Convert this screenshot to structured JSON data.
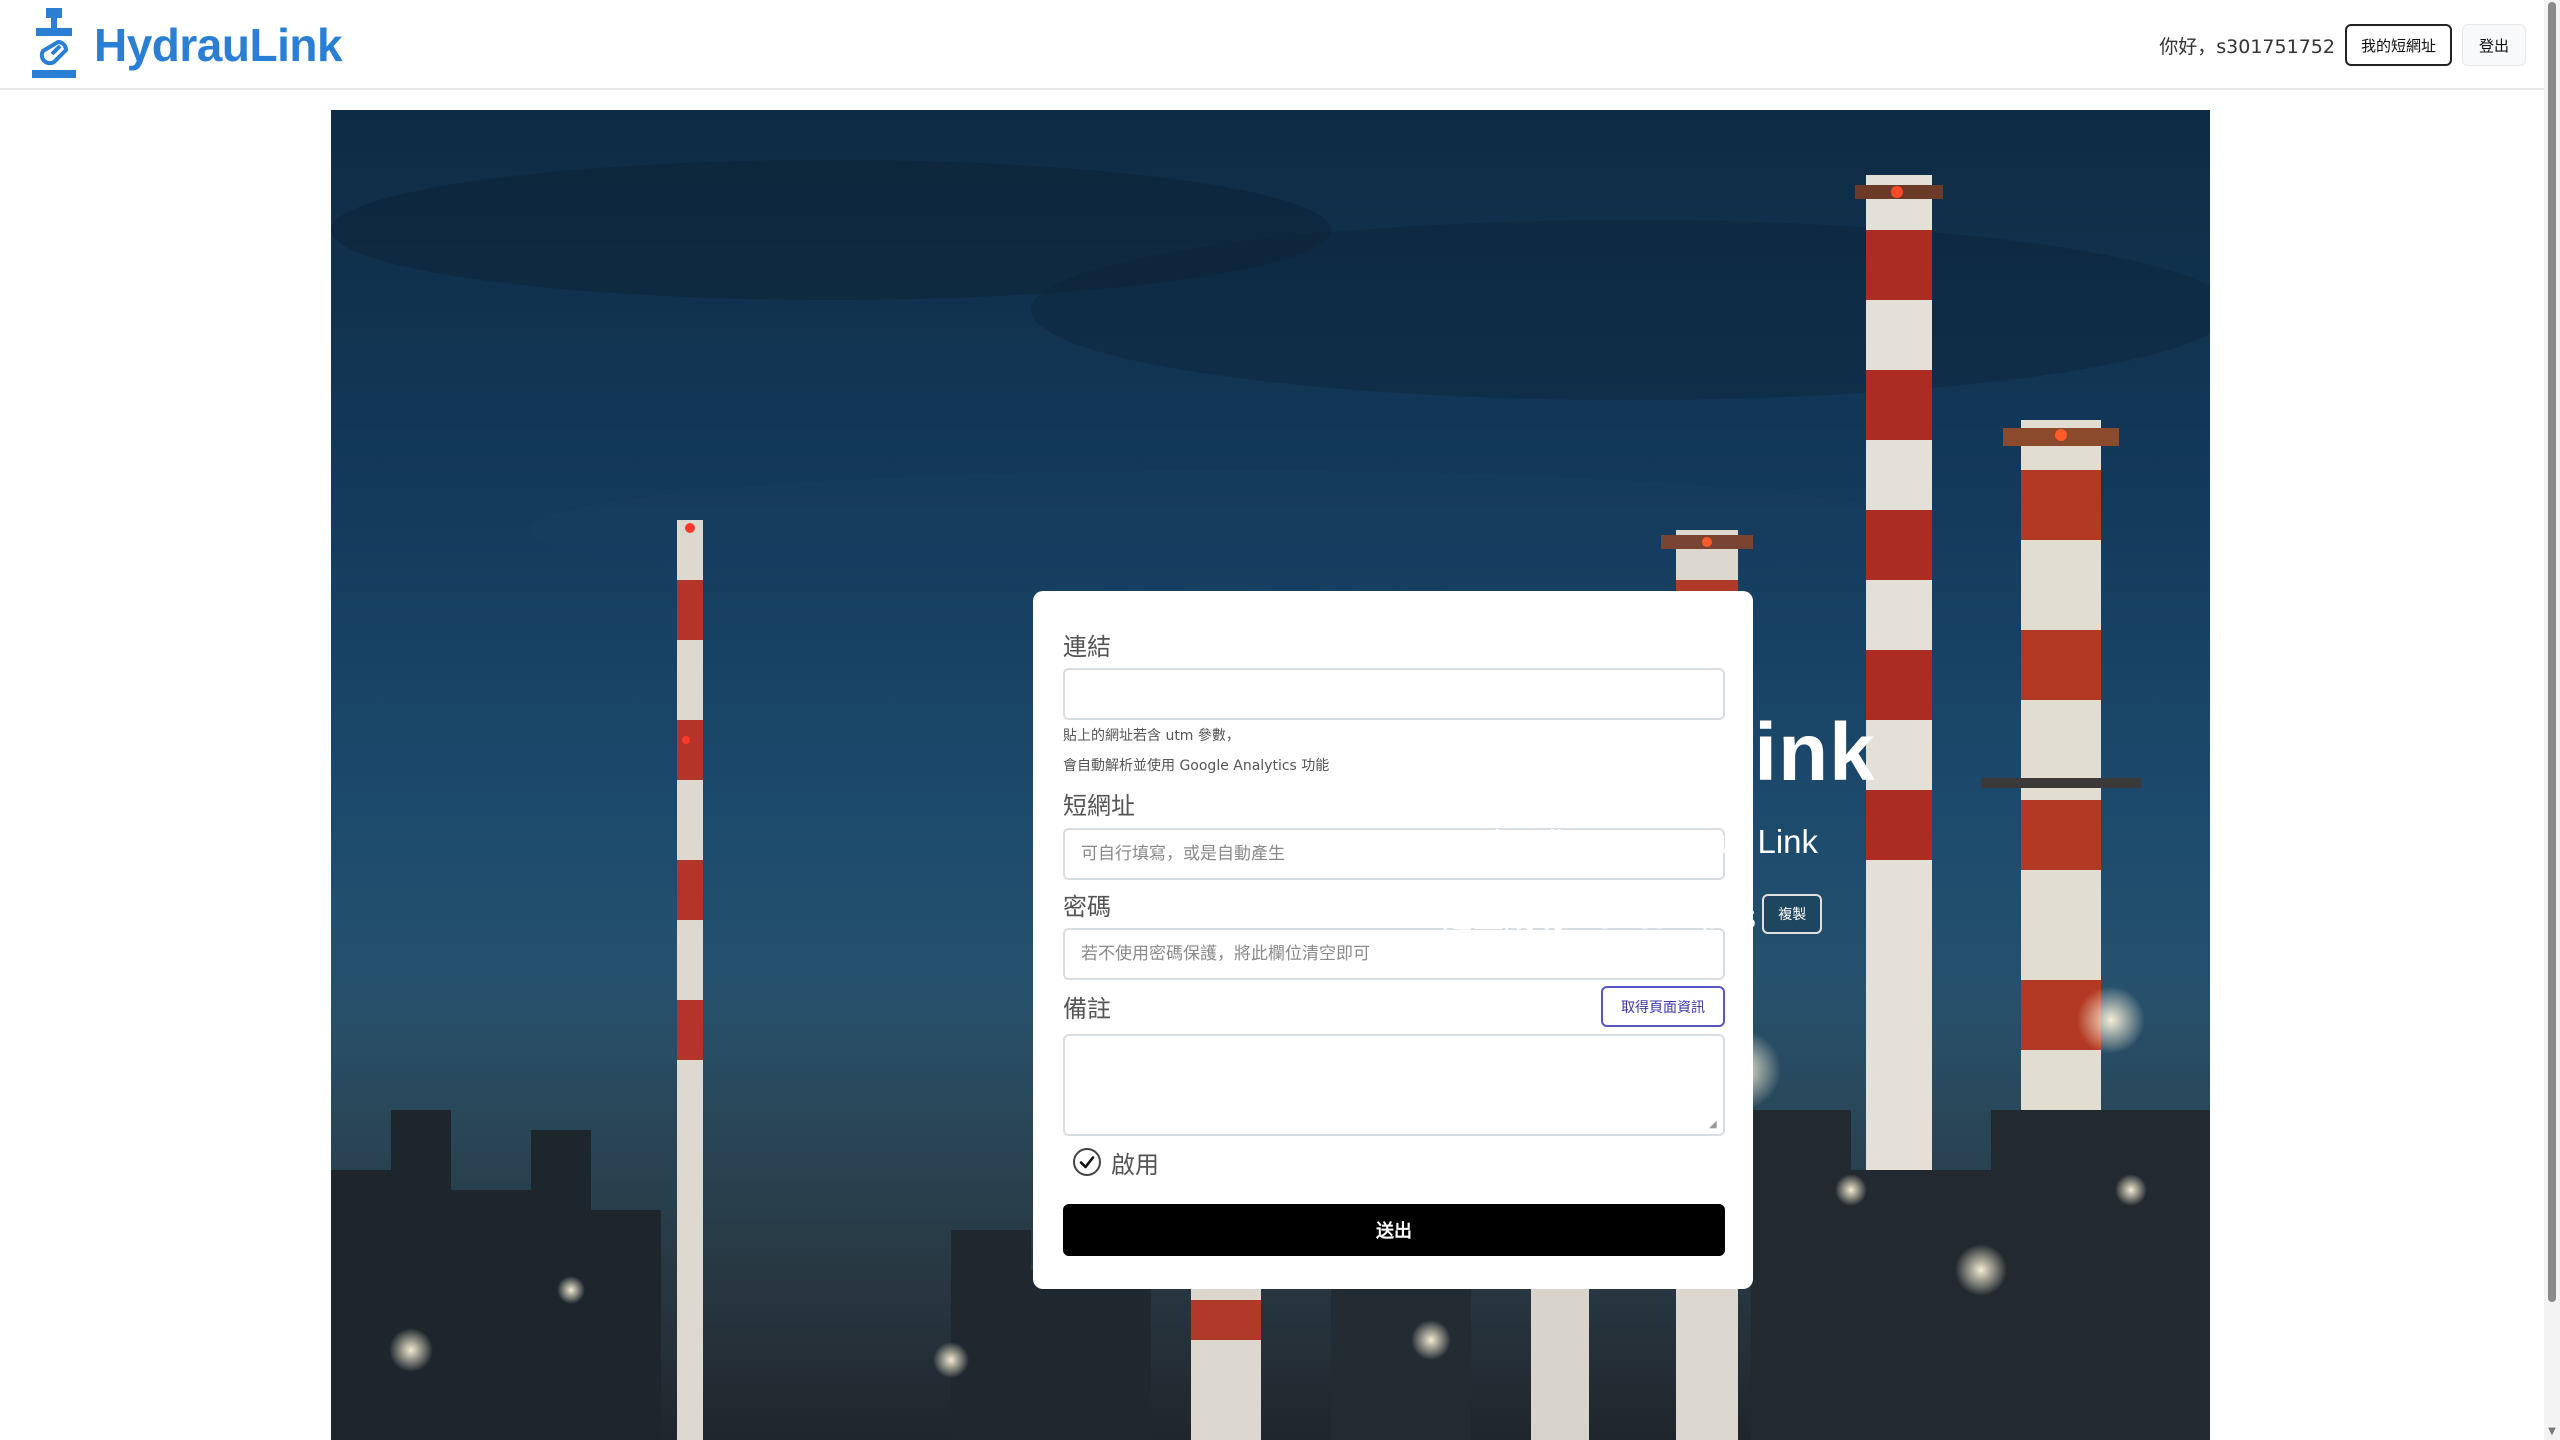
{
  "header": {
    "brand": "HydrauLink",
    "greeting": "你好，s301751752",
    "my_links_label": "我的短網址",
    "logout_label": "登出"
  },
  "form": {
    "link_label": "連結",
    "link_value": "",
    "link_help_line1": "貼上的網址若含 utm 參數，",
    "link_help_line2": "會自動解析並使用 Google Analytics 功能",
    "short_label": "短網址",
    "short_placeholder": "可自行填寫，或是自動產生",
    "password_label": "密碼",
    "password_placeholder": "若不使用密碼保護，將此欄位清空即可",
    "note_label": "備註",
    "fetch_label": "取得頁面資訊",
    "note_value": "",
    "enable_label": "啟用",
    "enable_checked": true,
    "submit_label": "送出"
  },
  "hero": {
    "title": "Hydraulink",
    "subtitle": "Hydraulic Press Your Link",
    "result_text": "建立成功：5xcampus",
    "copy_label": "複製"
  },
  "colors": {
    "brand": "#2a7fd4",
    "fetch_button": "#5a55c7",
    "submit_button": "#000000"
  }
}
